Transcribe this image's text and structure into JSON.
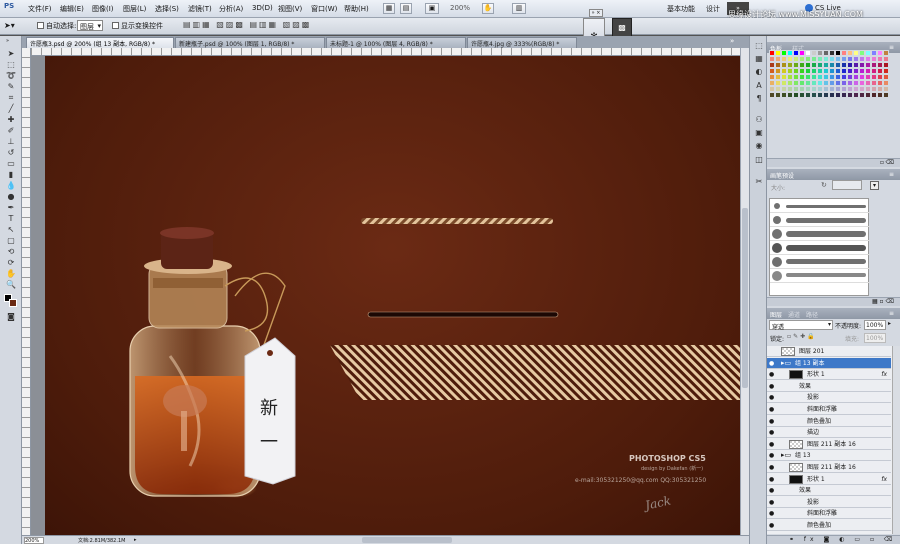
{
  "app": {
    "logo": "PS"
  },
  "menu": {
    "items": [
      "文件(F)",
      "编辑(E)",
      "图像(I)",
      "图层(L)",
      "选择(S)",
      "滤镜(T)",
      "分析(A)",
      "3D(D)",
      "视图(V)",
      "窗口(W)",
      "帮助(H)"
    ]
  },
  "appbar": {
    "zoom": "200%",
    "workspace_basic": "基本功能",
    "workspace_design": "设计",
    "cs_live": "CS Live",
    "watermark": "思缘设计论坛 www.MISSYUAN.COM"
  },
  "options": {
    "auto_select_label": "自动选择:",
    "auto_select_value": "图层",
    "show_transform_label": "显示变换控件"
  },
  "doc_tabs": [
    {
      "label": "许愿瓶3.psd @ 200% (组 13 副本, RGB/8) *",
      "active": true
    },
    {
      "label": "新建瓶子.psd @ 100% (图层 1, RGB/8) *",
      "active": false
    },
    {
      "label": "未标题-1 @ 100% (图层 4, RGB/8) *",
      "active": false
    },
    {
      "label": "许愿瓶4.jpg @ 333%(RGB/8) *",
      "active": false
    }
  ],
  "canvas": {
    "tag_text_1": "新",
    "tag_text_2": "一",
    "brand": "PHOTOSHOP CS5",
    "credit": "design by Dakefan (新一)",
    "email": "e-mail:305321250@qq.com  QQ:305321250",
    "signature": "Jack"
  },
  "status": {
    "zoom": "200%",
    "doc_info": "文档:2.81M/382.1M"
  },
  "panels": {
    "swatch_tabs": [
      "色板",
      "样式"
    ],
    "brush_tab": "画笔预设",
    "brush_size_label": "大小:",
    "layer_tabs": [
      "图层",
      "通道",
      "路径"
    ],
    "blend_mode": "穿透",
    "opacity_label": "不透明度:",
    "opacity_value": "100%",
    "lock_label": "锁定:",
    "fill_label": "填充:",
    "fill_value": "100%",
    "layers": [
      {
        "name": "图层 201",
        "indent": 0,
        "thumb": "checker",
        "eye": "",
        "selected": false
      },
      {
        "name": "组 13 副本",
        "indent": 0,
        "thumb": "folder",
        "eye": "●",
        "selected": true
      },
      {
        "name": "形状 1",
        "indent": 1,
        "thumb": "black",
        "eye": "●",
        "fx": "fx",
        "selected": false
      },
      {
        "name": "效果",
        "indent": 2,
        "thumb": "",
        "eye": "●",
        "selected": false
      },
      {
        "name": "投影",
        "indent": 3,
        "thumb": "",
        "eye": "●",
        "selected": false
      },
      {
        "name": "斜面和浮雕",
        "indent": 3,
        "thumb": "",
        "eye": "●",
        "selected": false
      },
      {
        "name": "颜色叠加",
        "indent": 3,
        "thumb": "",
        "eye": "●",
        "selected": false
      },
      {
        "name": "描边",
        "indent": 3,
        "thumb": "",
        "eye": "●",
        "selected": false
      },
      {
        "name": "图层 211 副本 16",
        "indent": 1,
        "thumb": "checker",
        "eye": "●",
        "selected": false
      },
      {
        "name": "组 13",
        "indent": 0,
        "thumb": "folder",
        "eye": "●",
        "selected": false
      },
      {
        "name": "图层 211 副本 16",
        "indent": 1,
        "thumb": "checker",
        "eye": "●",
        "selected": false
      },
      {
        "name": "形状 1",
        "indent": 1,
        "thumb": "black",
        "eye": "●",
        "fx": "fx",
        "selected": false
      },
      {
        "name": "效果",
        "indent": 2,
        "thumb": "",
        "eye": "●",
        "selected": false
      },
      {
        "name": "投影",
        "indent": 3,
        "thumb": "",
        "eye": "●",
        "selected": false
      },
      {
        "name": "斜面和浮雕",
        "indent": 3,
        "thumb": "",
        "eye": "●",
        "selected": false
      },
      {
        "name": "颜色叠加",
        "indent": 3,
        "thumb": "",
        "eye": "●",
        "selected": false
      }
    ]
  },
  "colors": {
    "canvas_bg": "#4e1c0b",
    "rope": "#d9b48a",
    "stripe": "#e6c9a2",
    "selection": "#3d78c8"
  }
}
